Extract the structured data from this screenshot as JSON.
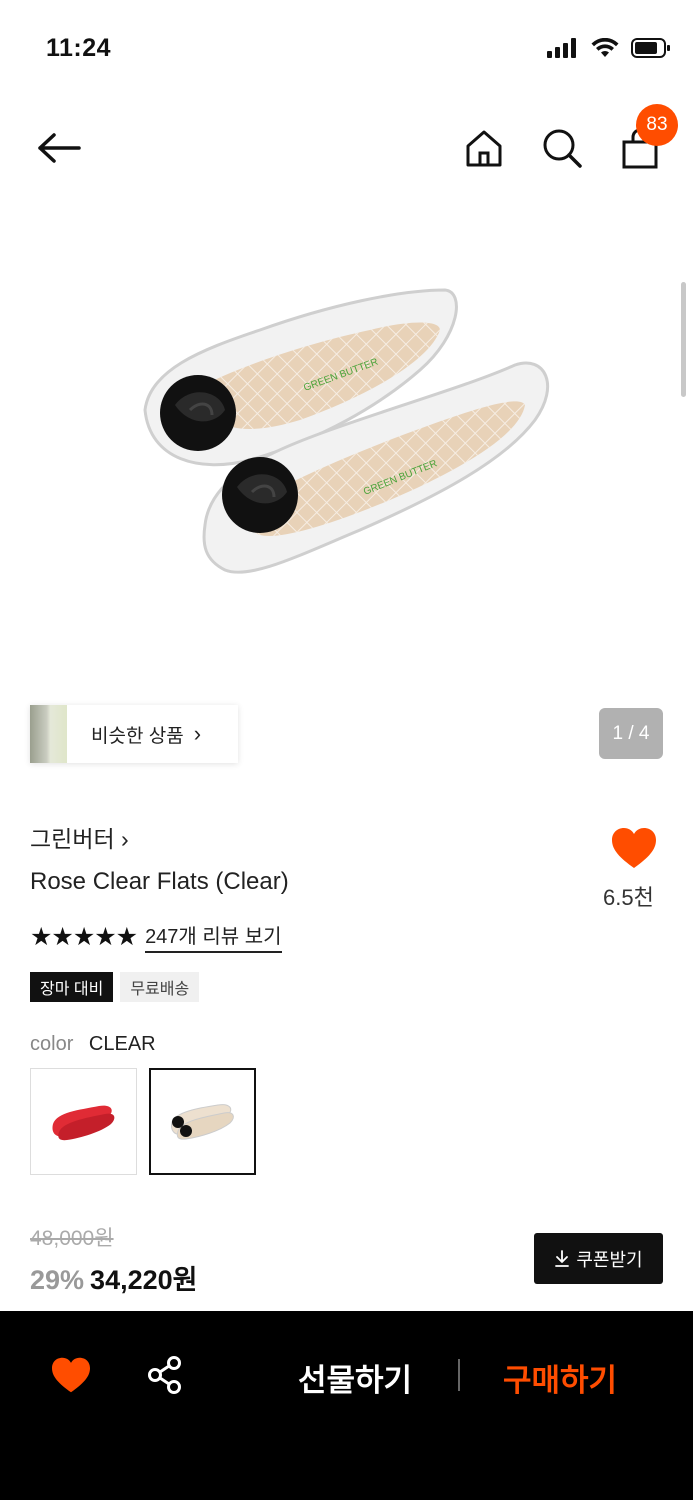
{
  "status": {
    "time": "11:24"
  },
  "nav": {
    "cart_count": "83"
  },
  "gallery": {
    "page_counter": "1 / 4"
  },
  "similar": {
    "label": "비슷한 상품",
    "chevron": "›"
  },
  "product": {
    "brand": "그린버터 ›",
    "name": "Rose Clear Flats (Clear)",
    "stars": "★★★★★",
    "review_link": "247개 리뷰 보기",
    "like_count": "6.5천",
    "rating": 5
  },
  "tags": [
    "장마 대비",
    "무료배송"
  ],
  "color": {
    "key": "color",
    "value": "CLEAR",
    "swatch_names": [
      "red-flats",
      "clear-flats"
    ],
    "selected_index": 1
  },
  "price": {
    "original": "48,000원",
    "discount": "29%",
    "sale": "34,220원"
  },
  "coupon": {
    "icon": "download-icon",
    "label": "쿠폰받기"
  },
  "bottom_bar": {
    "gift_label": "선물하기",
    "buy_label": "구매하기"
  },
  "colors": {
    "accent": "#ff4d00",
    "black": "#000000",
    "counter_bg": "#b1b1b1"
  }
}
